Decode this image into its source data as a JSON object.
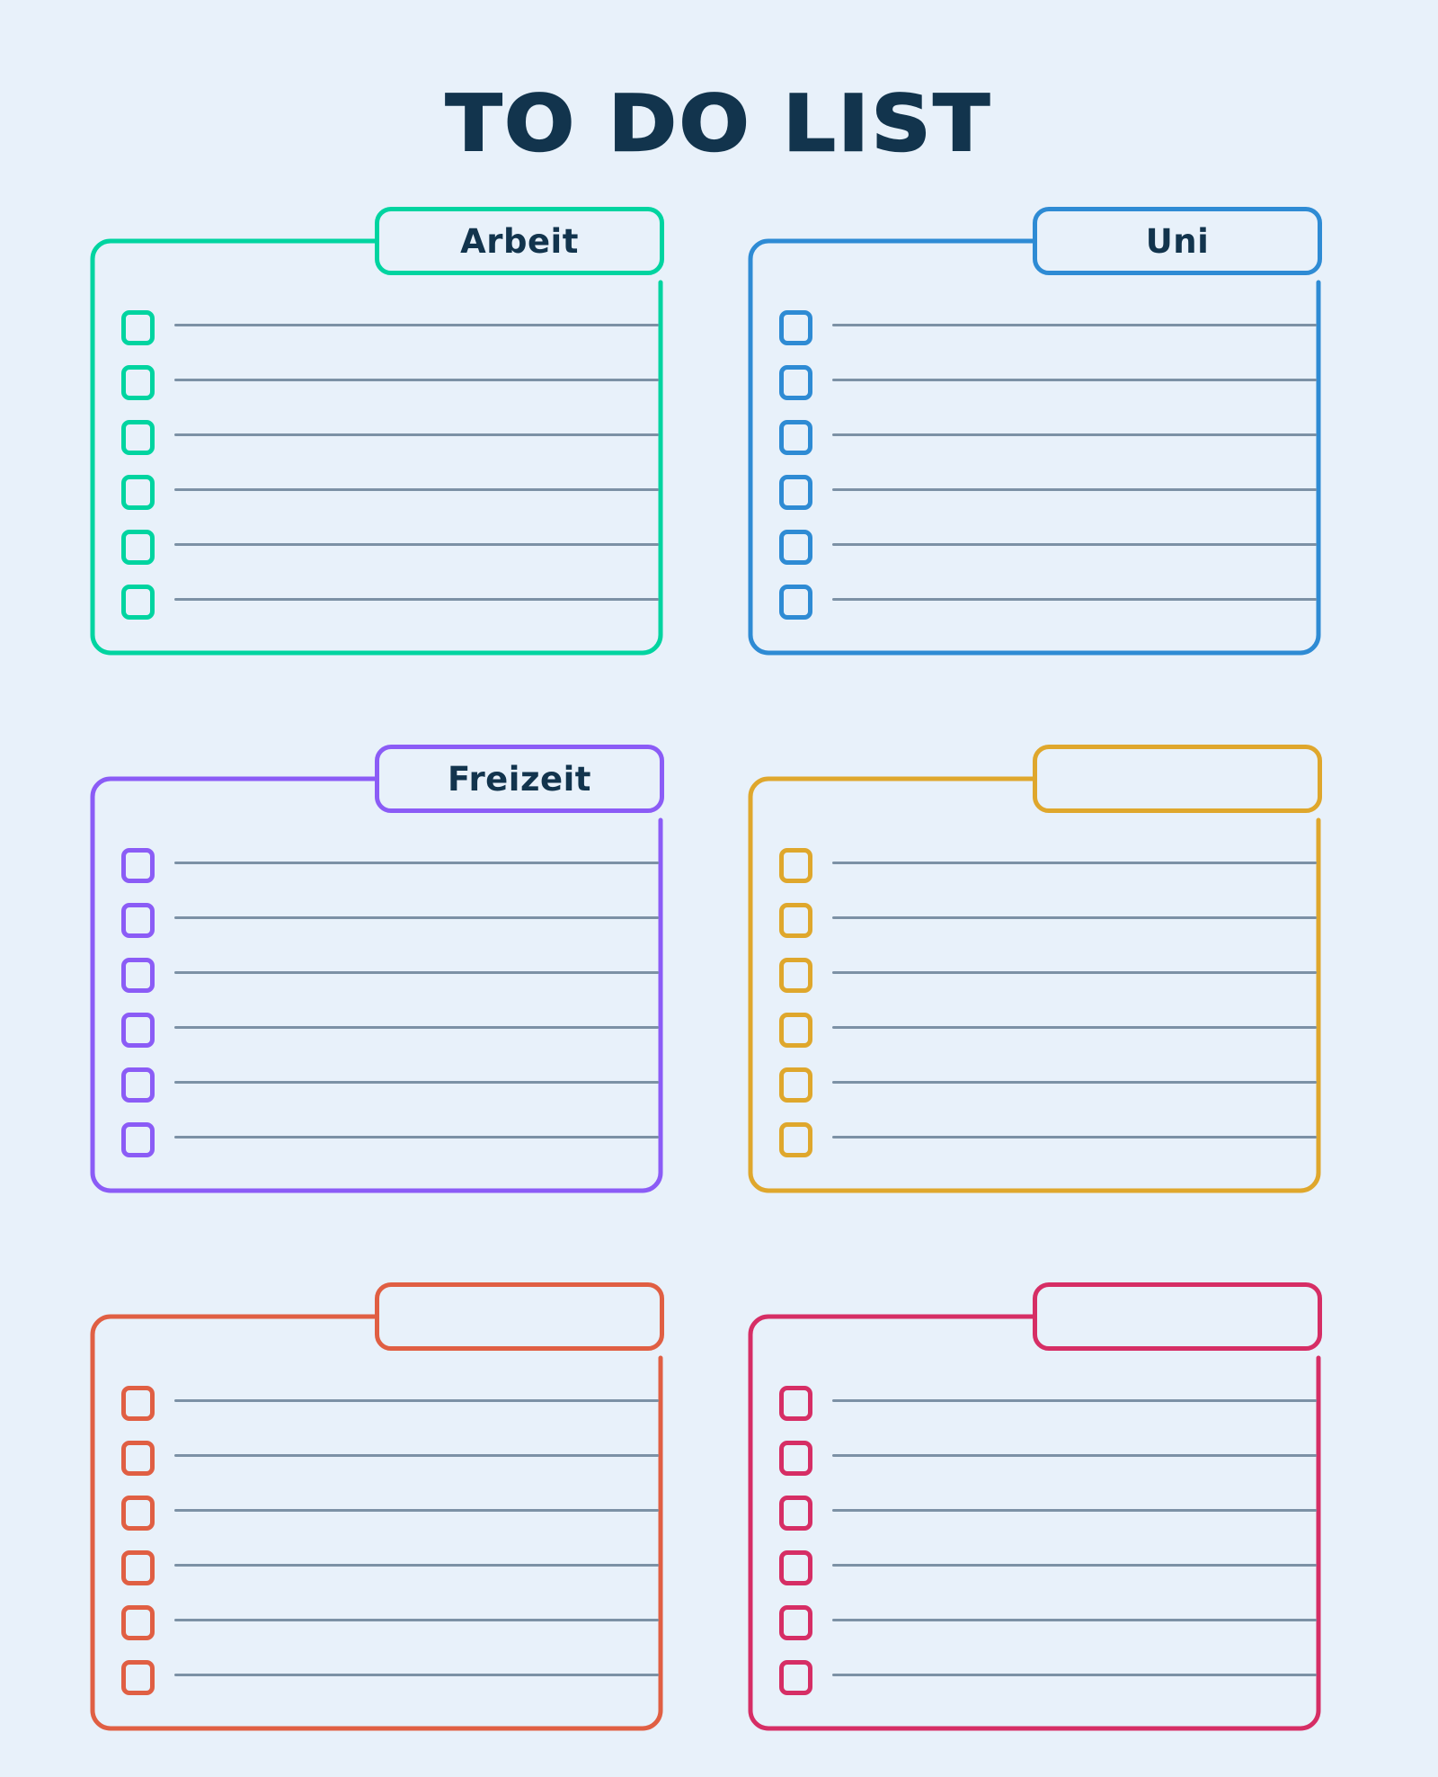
{
  "page": {
    "title": "TO DO LIST",
    "background_color": "#e8f1fa",
    "title_color": "#12344d",
    "line_color": "#7c91a5"
  },
  "cards": [
    {
      "id": "arbeit",
      "tab_label": "Arbeit",
      "accent_color": "#00d4a0",
      "accent_class": "accent-teal",
      "rows": 6
    },
    {
      "id": "uni",
      "tab_label": "Uni",
      "accent_color": "#2e8bd4",
      "accent_class": "accent-blue",
      "rows": 6
    },
    {
      "id": "freizeit",
      "tab_label": "Freizeit",
      "accent_color": "#8b5cf6",
      "accent_class": "accent-purple",
      "rows": 6
    },
    {
      "id": "amber",
      "tab_label": "",
      "accent_color": "#dfa72c",
      "accent_class": "accent-amber",
      "rows": 6
    },
    {
      "id": "orange",
      "tab_label": "",
      "accent_color": "#e05f43",
      "accent_class": "accent-orange",
      "rows": 6
    },
    {
      "id": "pink",
      "tab_label": "",
      "accent_color": "#d62e65",
      "accent_class": "accent-pink",
      "rows": 6
    }
  ]
}
